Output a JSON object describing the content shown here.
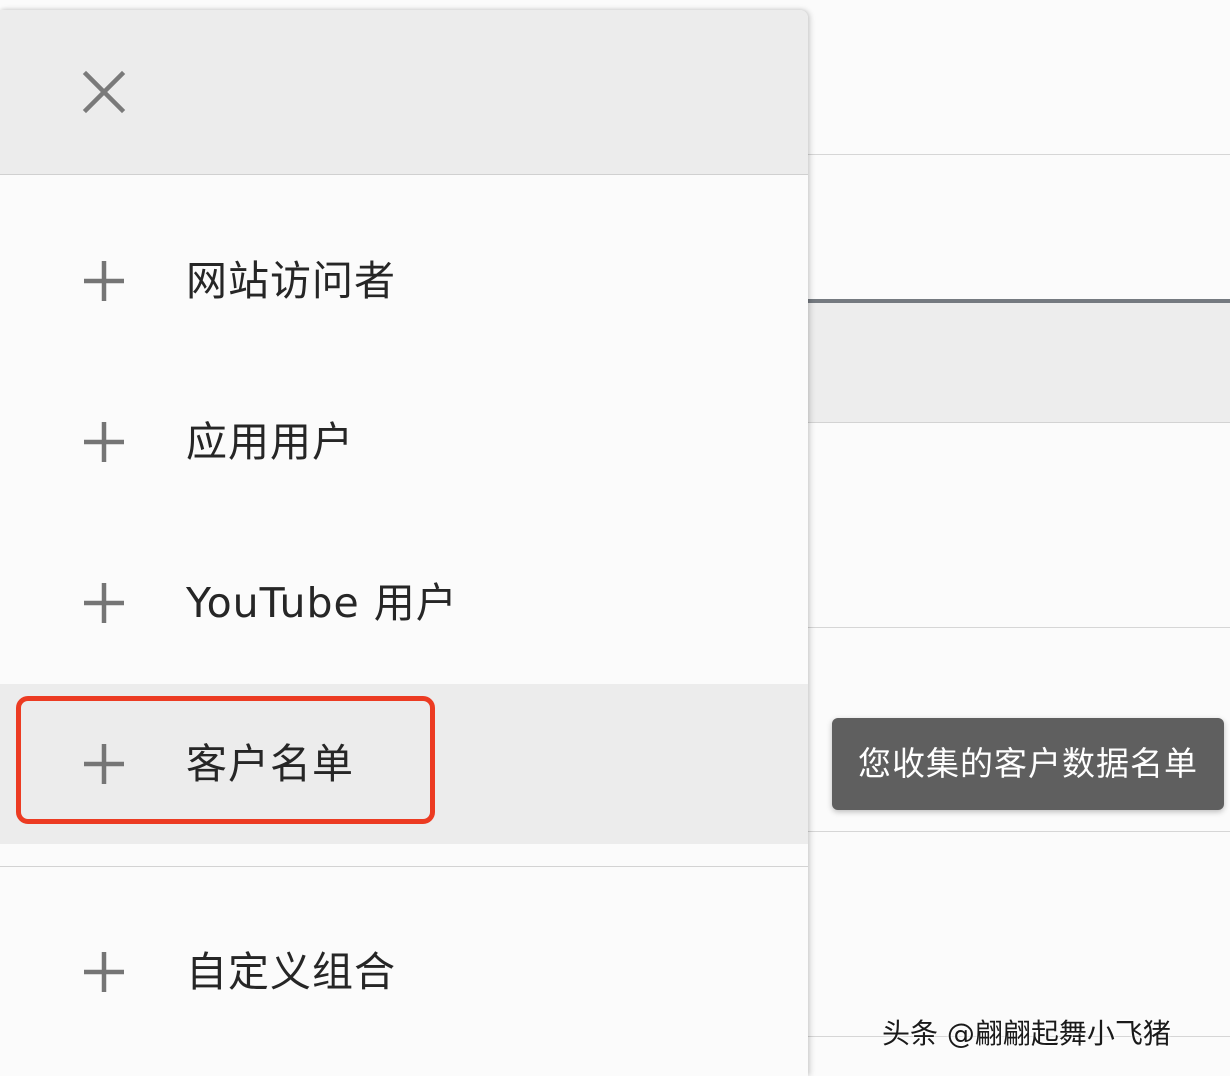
{
  "menu": {
    "close_icon": "close-icon",
    "items": [
      {
        "label": "网站访问者",
        "icon": "plus-icon",
        "highlighted": false
      },
      {
        "label": "应用用户",
        "icon": "plus-icon",
        "highlighted": false
      },
      {
        "label": "YouTube 用户",
        "icon": "plus-icon",
        "highlighted": false
      },
      {
        "label": "客户名单",
        "icon": "plus-icon",
        "highlighted": true
      },
      {
        "label": "自定义组合",
        "icon": "plus-icon",
        "highlighted": false
      }
    ]
  },
  "tooltip": {
    "text": "您收集的客户数据名单"
  },
  "annotation": {
    "color": "#ec3b22"
  },
  "watermark": {
    "text": "头条 @翩翩起舞小飞猪"
  },
  "colors": {
    "header_bg": "#ececec",
    "panel_bg": "#fbfbfb",
    "icon_grey": "#757575",
    "tooltip_bg": "#5f5f5f"
  }
}
